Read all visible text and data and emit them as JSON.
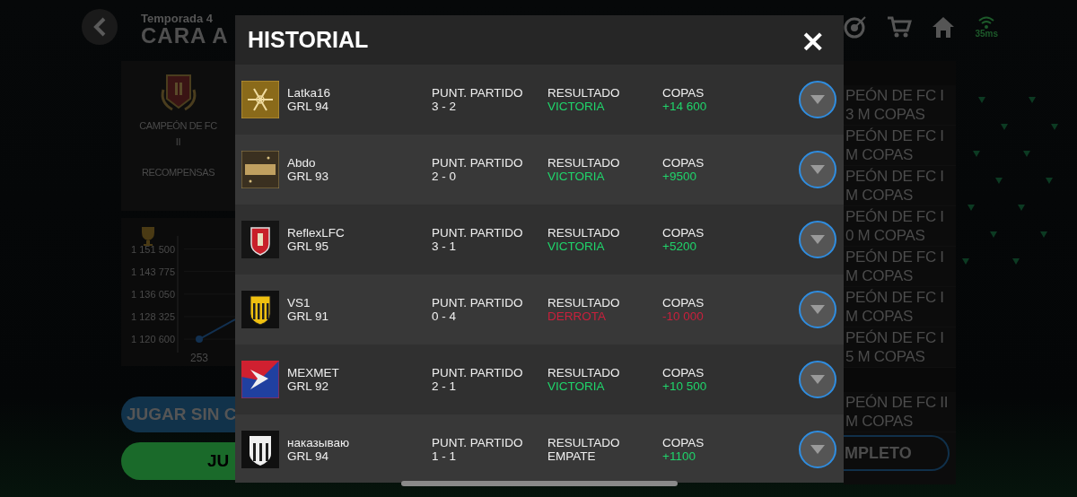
{
  "header": {
    "subtitle": "Temporada 4",
    "title": "CARA A"
  },
  "top_bar": {
    "ping": "35ms"
  },
  "rank_panel": {
    "rank": "CAMPEÓN DE FC",
    "division": "II",
    "rewards": "RECOMPENSAS"
  },
  "progress_chart": {
    "chart_data": {
      "type": "line",
      "x": [
        "253"
      ],
      "series": [
        {
          "values": [
            1120600
          ],
          "marker": true
        }
      ],
      "ylim": [
        1116000,
        1156000
      ],
      "grid": true,
      "yticks": [
        {
          "value": 1151500,
          "label": "1 151 500"
        },
        {
          "value": 1143775,
          "label": "1 143 775"
        },
        {
          "value": 1136050,
          "label": "1 136 050"
        },
        {
          "value": 1128325,
          "label": "1 128 325"
        },
        {
          "value": 1120600,
          "label": "1 120 600"
        }
      ]
    }
  },
  "buttons": [
    "JUGAR SIN C",
    "JU"
  ],
  "rewards_list": {
    "groups": [
      {
        "items": [
          {
            "rank": "PEÓN DE FC I",
            "cups": "3 M COPAS"
          },
          {
            "rank": "PEÓN DE FC I",
            "cups": "M COPAS"
          },
          {
            "rank": "PEÓN DE FC I",
            "cups": "M COPAS"
          },
          {
            "rank": "PEÓN DE FC I",
            "cups": "0 M COPAS"
          },
          {
            "rank": "PEÓN DE FC I",
            "cups": "M COPAS"
          },
          {
            "rank": "PEÓN DE FC I",
            "cups": "M COPAS"
          },
          {
            "rank": "PEÓN DE FC I",
            "cups": "5 M COPAS"
          }
        ]
      },
      {
        "items": [
          {
            "rank": "PEÓN DE FC II",
            "cups": "M COPAS"
          }
        ]
      }
    ],
    "button": "MPLETO"
  },
  "modal": {
    "title": "HISTORIAL",
    "close": "×",
    "rows": [
      {
        "name": "Latka16",
        "rating": "GRL 94",
        "score_label": "PUNT. PARTIDO",
        "score": "3 - 2",
        "result_label": "RESULTADO",
        "result": "VICTORIA",
        "kind": "win",
        "cups_label": "COPAS",
        "cups": "+14 600"
      },
      {
        "name": "Abdo",
        "rating": "GRL 93",
        "score_label": "PUNT. PARTIDO",
        "score": "2 - 0",
        "result_label": "RESULTADO",
        "result": "VICTORIA",
        "kind": "win",
        "cups_label": "COPAS",
        "cups": "+9500"
      },
      {
        "name": "ReflexLFC",
        "rating": "GRL 95",
        "score_label": "PUNT. PARTIDO",
        "score": "3 - 1",
        "result_label": "RESULTADO",
        "result": "VICTORIA",
        "kind": "win",
        "cups_label": "COPAS",
        "cups": "+5200"
      },
      {
        "name": "VS1",
        "rating": "GRL 91",
        "score_label": "PUNT. PARTIDO",
        "score": "0 - 4",
        "result_label": "RESULTADO",
        "result": "DERROTA",
        "kind": "loss",
        "cups_label": "COPAS",
        "cups": "-10 000"
      },
      {
        "name": "MEXMET",
        "rating": "GRL 92",
        "score_label": "PUNT. PARTIDO",
        "score": "2 - 1",
        "result_label": "RESULTADO",
        "result": "VICTORIA",
        "kind": "win",
        "cups_label": "COPAS",
        "cups": "+10 500"
      },
      {
        "name": "наказываю",
        "rating": "GRL 94",
        "score_label": "PUNT. PARTIDO",
        "score": "1 - 1",
        "result_label": "RESULTADO",
        "result": "EMPATE",
        "kind": "draw",
        "cups_label": "COPAS",
        "cups": "+1100"
      }
    ]
  }
}
